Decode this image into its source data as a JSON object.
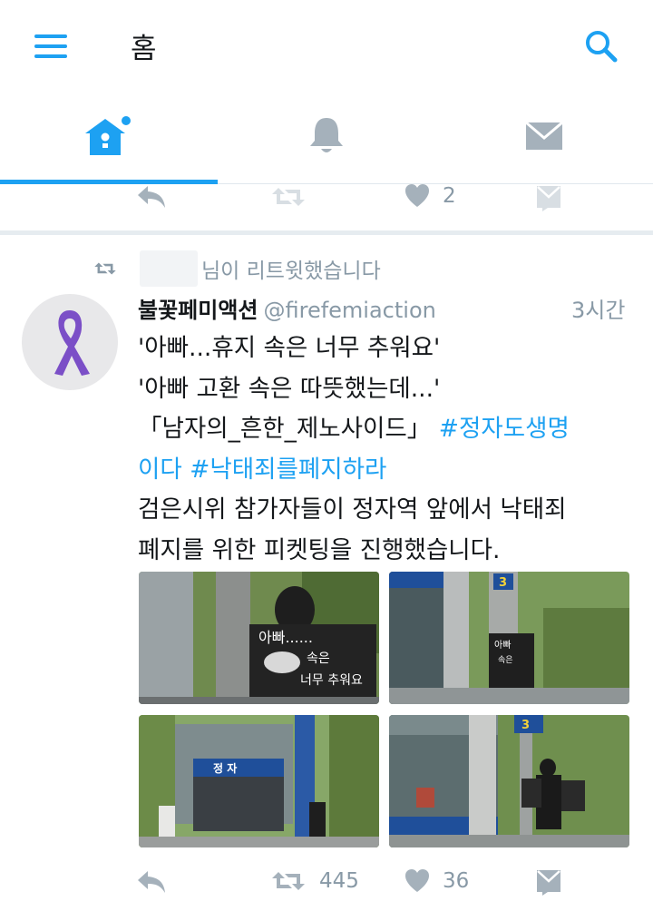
{
  "header": {
    "title": "홈"
  },
  "colors": {
    "accent": "#1da1f2",
    "muted": "#8899a6",
    "text": "#14171a",
    "ribbon": "#7b4fc7"
  },
  "icons": {
    "menu": "menu-icon",
    "search": "search-icon",
    "home": "home-icon",
    "notifications": "bell-icon",
    "messages": "envelope-icon",
    "reply": "reply-icon",
    "retweet": "retweet-icon",
    "like": "heart-icon",
    "direct_message": "dm-icon"
  },
  "previous_tweet": {
    "likes": "2"
  },
  "tweet": {
    "retweet_context": "님이 리트윗했습니다",
    "author_name": "불꽃페미액션",
    "author_handle": "@firefemiaction",
    "time": "3시간",
    "lines": [
      {
        "text": "'아빠...휴지 속은 너무 추워요'"
      },
      {
        "text": "'아빠 고환 속은 따뜻했는데...'"
      },
      {
        "text": "「남자의_흔한_제노사이드」",
        "tag": "#정자도생명"
      },
      {
        "text": "",
        "tag": "이다 #낙태죄를폐지하라"
      },
      {
        "text": "검은시위 참가자들이 정자역 앞에서 낙태죄"
      },
      {
        "text": "폐지를 위한 피켓팅을 진행했습니다."
      }
    ],
    "photos": [
      {
        "sign_line1": "아빠......",
        "sign_line2": "속은",
        "sign_line3": "너무 추워요"
      },
      {
        "station_number": "3",
        "sign_line1": "아빠",
        "sign_line2": "속은"
      },
      {
        "station_name": "정 자"
      },
      {
        "station_number": "3"
      }
    ],
    "retweets": "445",
    "likes": "36"
  }
}
